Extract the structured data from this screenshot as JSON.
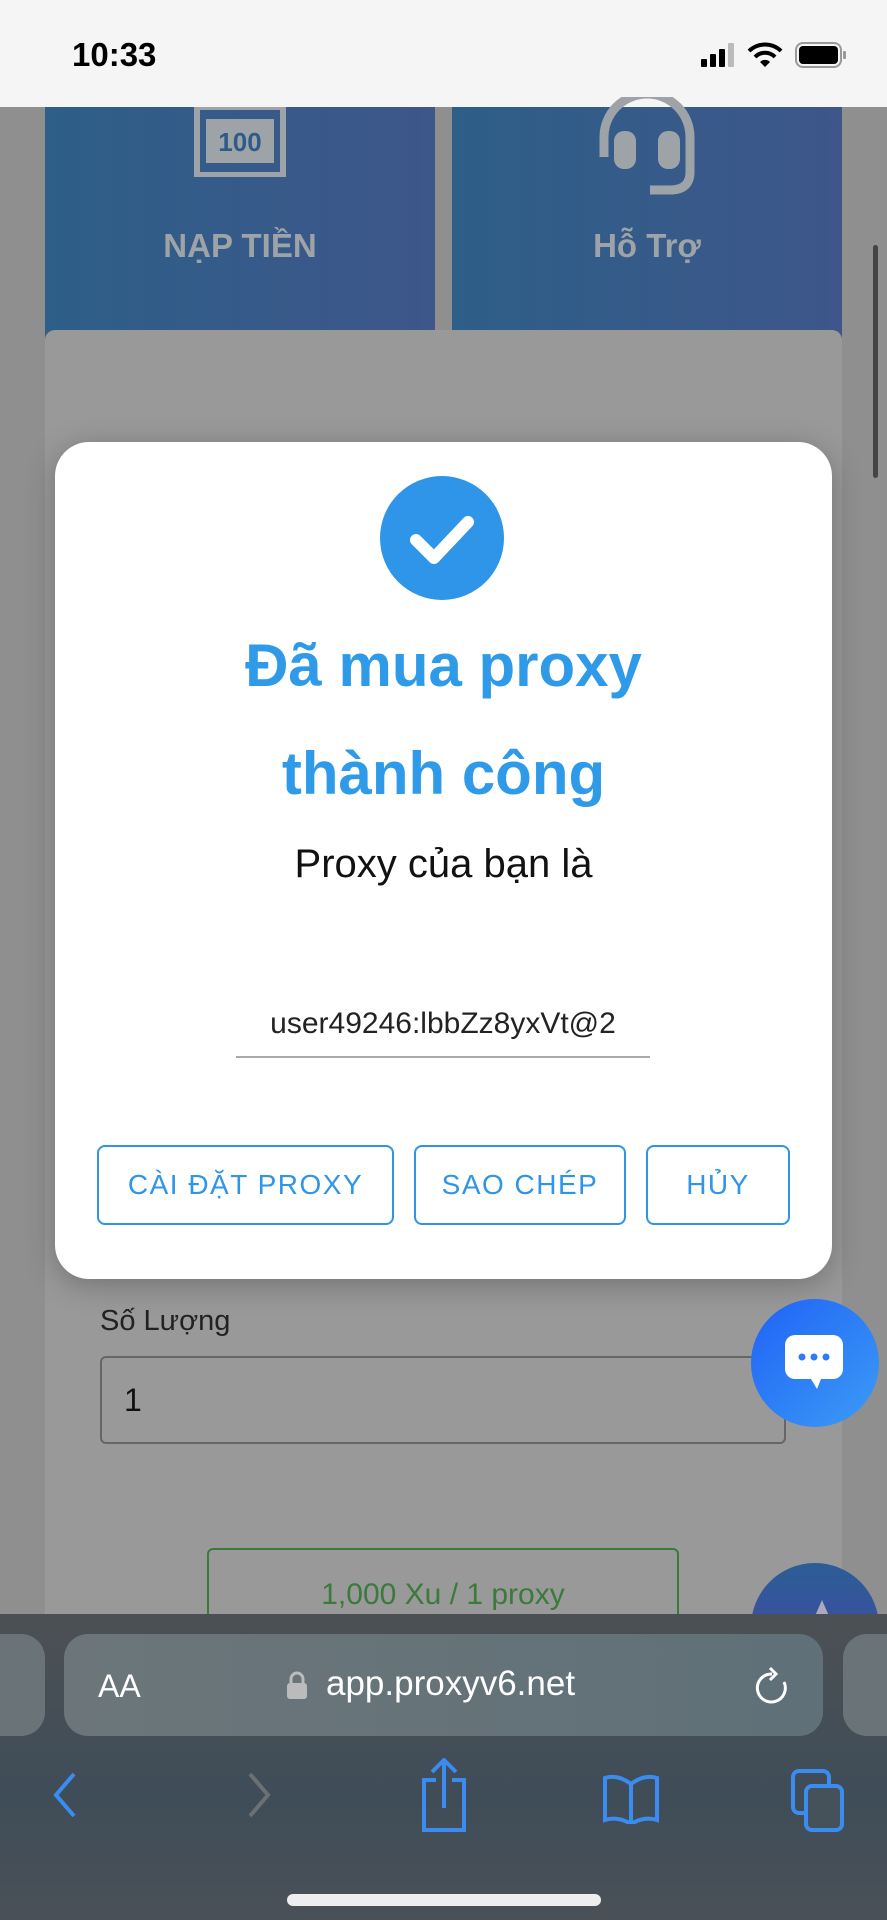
{
  "status_bar": {
    "time": "10:33"
  },
  "tiles": [
    {
      "label": "NẠP TIỀN",
      "icon": "money-bill-100-icon",
      "icon_text": "100"
    },
    {
      "label": "Hỗ Trợ",
      "icon": "headset-icon"
    }
  ],
  "modal": {
    "icon": "check-circle-icon",
    "title_line1": "Đã mua proxy",
    "title_line2": "thành công",
    "subtitle": "Proxy của bạn là",
    "proxy_value": "user49246:lbbZz8yxVt@2",
    "buttons": {
      "install": "CÀI ĐẶT PROXY",
      "copy": "SAO CHÉP",
      "cancel": "HỦY"
    },
    "accent": "#2f95e8"
  },
  "form": {
    "quantity_label": "Số Lượng",
    "quantity_value": "1",
    "price": "1,000 Xu / 1 proxy"
  },
  "browser": {
    "text_size": "AA",
    "url": "app.proxyv6.net"
  }
}
